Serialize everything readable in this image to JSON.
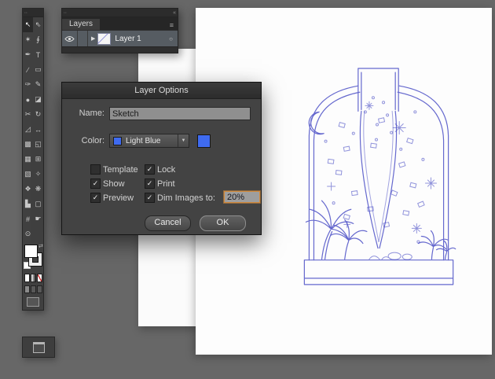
{
  "colors": {
    "accent_blue": "#3f6bf0",
    "sketch_stroke": "#4b4fc6",
    "focus_orange": "#d08a3e"
  },
  "window": {
    "grip_dots": "∙∙",
    "collapse_icon": "«"
  },
  "toolbar": {
    "tools": [
      {
        "name": "selection-tool",
        "glyph": "↖"
      },
      {
        "name": "direct-selection-tool",
        "glyph": "⇖"
      },
      {
        "name": "magic-wand-tool",
        "glyph": "✶"
      },
      {
        "name": "lasso-tool",
        "glyph": "∮"
      },
      {
        "name": "pen-tool",
        "glyph": "✒"
      },
      {
        "name": "type-tool",
        "glyph": "T"
      },
      {
        "name": "line-tool",
        "glyph": "∕"
      },
      {
        "name": "rectangle-tool",
        "glyph": "▭"
      },
      {
        "name": "paintbrush-tool",
        "glyph": "✑"
      },
      {
        "name": "pencil-tool",
        "glyph": "✎"
      },
      {
        "name": "blob-brush-tool",
        "glyph": "●"
      },
      {
        "name": "eraser-tool",
        "glyph": "◪"
      },
      {
        "name": "scissors-tool",
        "glyph": "✂"
      },
      {
        "name": "rotate-tool",
        "glyph": "↻"
      },
      {
        "name": "scale-tool",
        "glyph": "◿"
      },
      {
        "name": "width-tool",
        "glyph": "↔"
      },
      {
        "name": "free-transform-tool",
        "glyph": "▩"
      },
      {
        "name": "shape-builder-tool",
        "glyph": "◱"
      },
      {
        "name": "perspective-grid-tool",
        "glyph": "▦"
      },
      {
        "name": "mesh-tool",
        "glyph": "⊞"
      },
      {
        "name": "gradient-tool",
        "glyph": "▧"
      },
      {
        "name": "eyedropper-tool",
        "glyph": "✧"
      },
      {
        "name": "blend-tool",
        "glyph": "❖"
      },
      {
        "name": "symbol-sprayer-tool",
        "glyph": "❋"
      },
      {
        "name": "column-graph-tool",
        "glyph": "▙"
      },
      {
        "name": "artboard-tool",
        "glyph": "▢"
      },
      {
        "name": "slice-tool",
        "glyph": "#"
      },
      {
        "name": "hand-tool",
        "glyph": "☛"
      },
      {
        "name": "zoom-tool",
        "glyph": "⊙"
      },
      {
        "name": "blank",
        "glyph": ""
      }
    ]
  },
  "layers_panel": {
    "tab": "Layers",
    "menu_icon": "≡",
    "layer": {
      "name": "Layer 1",
      "disclosure": "▶",
      "target_icon": "○"
    }
  },
  "dialog": {
    "title": "Layer Options",
    "name_label": "Name:",
    "name_value": "Sketch",
    "color_label": "Color:",
    "color_value": "Light Blue",
    "dropdown_arrow": "▼",
    "checkboxes": [
      {
        "label": "Template",
        "mark": ""
      },
      {
        "label": "Lock",
        "mark": "✓"
      },
      {
        "label": "Show",
        "mark": "✓"
      },
      {
        "label": "Print",
        "mark": "✓"
      },
      {
        "label": "Preview",
        "mark": "✓"
      },
      {
        "label": "Dim Images to:",
        "mark": "✓"
      }
    ],
    "dim_value": "20%",
    "cancel_label": "Cancel",
    "ok_label": "OK"
  }
}
